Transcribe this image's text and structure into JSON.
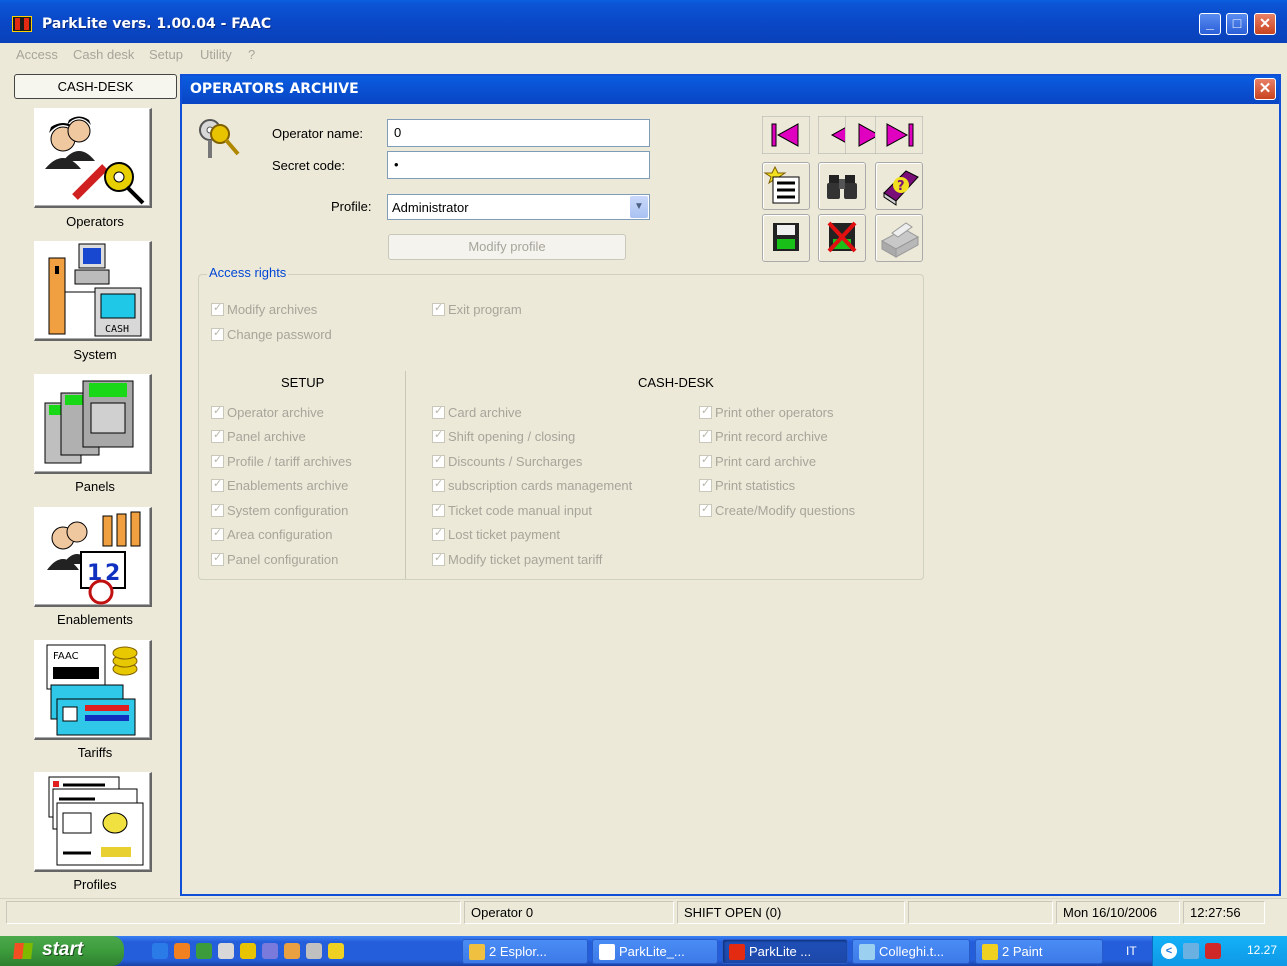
{
  "window": {
    "title": "ParkLite vers. 1.00.04 - FAAC"
  },
  "menu": [
    "Access",
    "Cash desk",
    "Setup",
    "Utility",
    "?"
  ],
  "sidebar": {
    "header_button": "CASH-DESK",
    "items": [
      {
        "label": "Operators",
        "icon": "operators-icon"
      },
      {
        "label": "System",
        "icon": "system-icon"
      },
      {
        "label": "Panels",
        "icon": "panels-icon"
      },
      {
        "label": "Enablements",
        "icon": "enablements-icon"
      },
      {
        "label": "Tariffs",
        "icon": "tariffs-icon"
      },
      {
        "label": "Profiles",
        "icon": "profiles-icon"
      }
    ]
  },
  "child_window": {
    "title": "OPERATORS ARCHIVE",
    "form": {
      "operator_name_label": "Operator name:",
      "operator_name_value": "0",
      "secret_code_label": "Secret code:",
      "secret_code_value": "•",
      "profile_label": "Profile:",
      "profile_value": "Administrator",
      "modify_profile_button": "Modify profile"
    },
    "toolbar": {
      "nav": [
        "first-record-icon",
        "previous-record-icon",
        "next-record-icon",
        "last-record-icon"
      ],
      "tools": [
        "new-record-icon",
        "search-binoculars-icon",
        "help-book-icon",
        "save-disk-icon",
        "delete-record-icon",
        "print-icon"
      ]
    },
    "access_rights": {
      "title": "Access rights",
      "general": [
        "Modify archives",
        "Change password",
        "Exit program"
      ],
      "setup_title": "SETUP",
      "setup": [
        "Operator archive",
        "Panel archive",
        "Profile / tariff archives",
        "Enablements archive",
        "System configuration",
        "Area configuration",
        "Panel configuration"
      ],
      "cashdesk_title": "CASH-DESK",
      "cashdesk_col1": [
        "Card archive",
        "Shift opening / closing",
        "Discounts / Surcharges",
        "subscription cards management",
        "Ticket code manual input",
        "Lost ticket payment",
        "Modify ticket payment tariff"
      ],
      "cashdesk_col2": [
        "Print other operators",
        "Print record archive",
        "Print card archive",
        "Print statistics",
        "Create/Modify questions"
      ]
    }
  },
  "statusbar": {
    "operator": "Operator 0",
    "shift": "SHIFT OPEN (0)",
    "date": "Mon 16/10/2006",
    "time": "12:27:56"
  },
  "taskbar": {
    "start_label": "start",
    "tasks": [
      "2 Esplor...",
      "ParkLite_...",
      "ParkLite ...",
      "Colleghi.t...",
      "2 Paint"
    ],
    "language": "IT",
    "clock": "12.27"
  },
  "colors": {
    "titlebar": "#0a48c8",
    "accent_blue": "#0046d5",
    "disabled_text": "#a7a59a",
    "nav_magenta": "#e000c0"
  }
}
